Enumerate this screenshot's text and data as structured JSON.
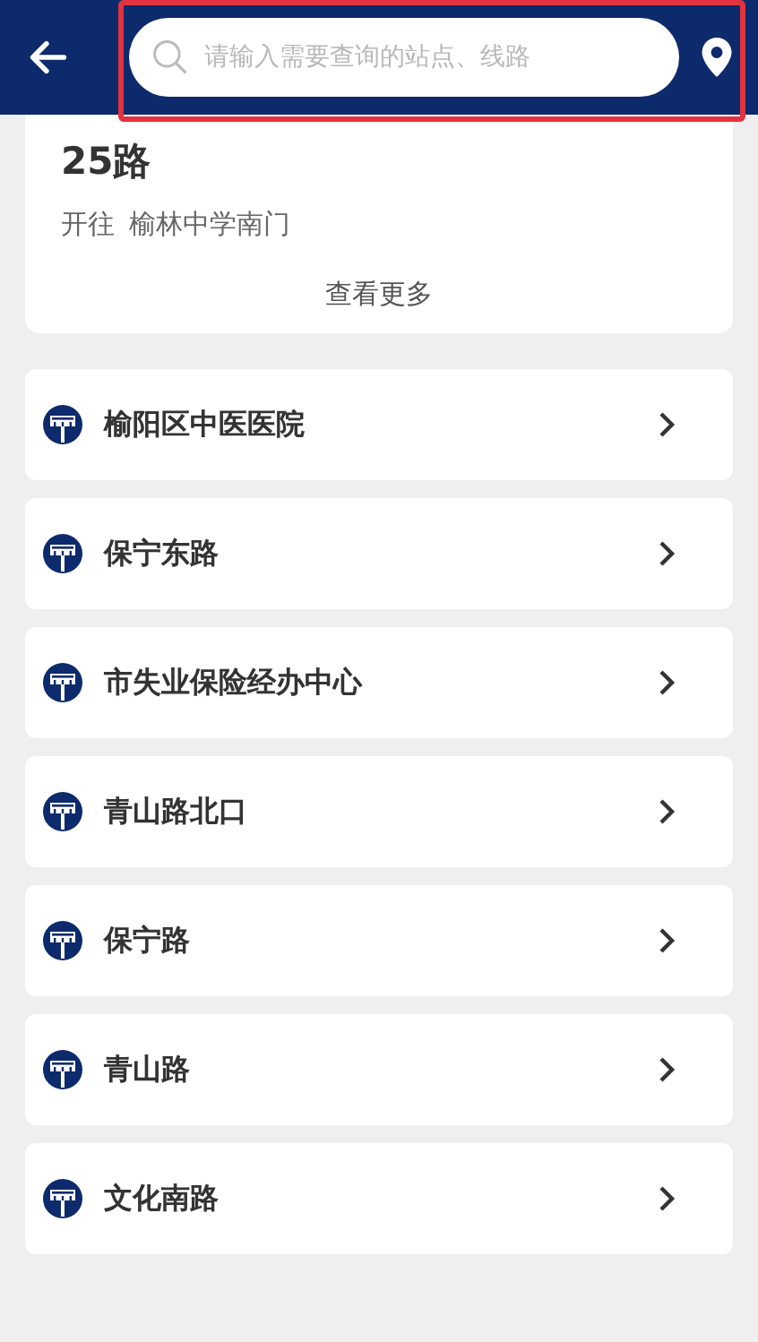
{
  "header": {
    "search": {
      "placeholder": "请输入需要查询的站点、线路"
    },
    "highlighted": true
  },
  "route_card": {
    "name": "25路",
    "direction_label": "开往",
    "destination": "榆林中学南门",
    "more": "查看更多"
  },
  "stops": [
    {
      "name": "榆阳区中医医院"
    },
    {
      "name": "保宁东路"
    },
    {
      "name": "市失业保险经办中心"
    },
    {
      "name": "青山路北口"
    },
    {
      "name": "保宁路"
    },
    {
      "name": "青山路"
    },
    {
      "name": "文化南路"
    }
  ]
}
